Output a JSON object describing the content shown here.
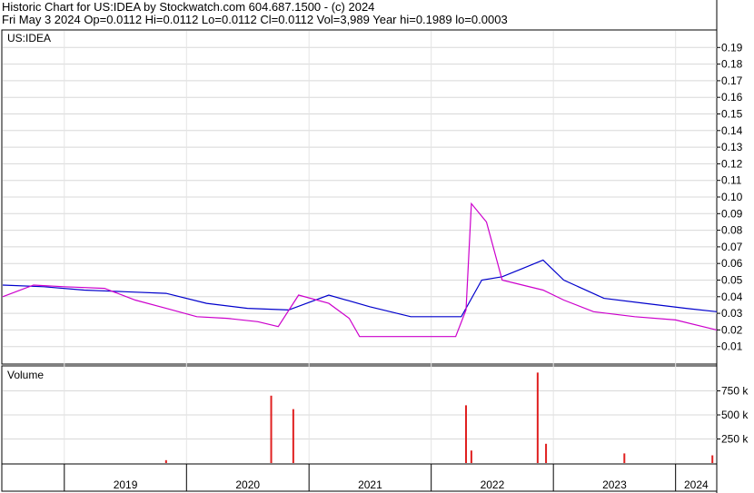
{
  "header": {
    "line1": "Historic Chart for US:IDEA by Stockwatch.com 604.687.1500 - (c) 2024",
    "line2": "Fri May  3 2024   Op=0.0112   Hi=0.0112   Lo=0.0112   Cl=0.0112   Vol=3,989   Year hi=0.1989   lo=0.0003"
  },
  "chart_data": {
    "type": "bar",
    "symbol_label": "US:IDEA",
    "volume_label": "Volume",
    "price_axis": {
      "range": [
        0,
        0.2
      ],
      "ticks": [
        "0.01",
        "0.02",
        "0.03",
        "0.04",
        "0.05",
        "0.06",
        "0.07",
        "0.08",
        "0.09",
        "0.10",
        "0.11",
        "0.12",
        "0.13",
        "0.14",
        "0.15",
        "0.16",
        "0.17",
        "0.18",
        "0.19"
      ]
    },
    "volume_axis": {
      "range": [
        0,
        1000000
      ],
      "ticks": [
        "250 k",
        "500 k",
        "750 k"
      ]
    },
    "time_axis": {
      "range": [
        "2018-07-01",
        "2024-05-03"
      ],
      "labels": [
        "2019",
        "2020",
        "2021",
        "2022",
        "2023",
        "2024"
      ]
    },
    "series": [
      {
        "name": "",
        "kind": "moving-average-long",
        "color": "#0000cc",
        "x": [
          "2018-07-01",
          "2018-11-01",
          "2019-03-01",
          "2019-07-01",
          "2019-11-01",
          "2020-03-01",
          "2020-07-01",
          "2020-11-01",
          "2021-03-01",
          "2021-07-01",
          "2021-11-01",
          "2022-02-01",
          "2022-04-01",
          "2022-06-01",
          "2022-08-01",
          "2022-10-01",
          "2022-12-01",
          "2023-02-01",
          "2023-06-01",
          "2023-10-01",
          "2024-02-01",
          "2024-05-03"
        ],
        "y": [
          0.047,
          0.046,
          0.044,
          0.043,
          0.042,
          0.036,
          0.033,
          0.032,
          0.041,
          0.034,
          0.028,
          0.028,
          0.028,
          0.05,
          0.052,
          0.057,
          0.062,
          0.05,
          0.039,
          0.036,
          0.033,
          0.031
        ]
      },
      {
        "name": "",
        "kind": "moving-average-short",
        "color": "#cc00cc",
        "x": [
          "2018-07-01",
          "2018-10-01",
          "2019-01-01",
          "2019-05-01",
          "2019-08-01",
          "2019-11-01",
          "2020-02-01",
          "2020-05-01",
          "2020-08-01",
          "2020-10-01",
          "2020-12-01",
          "2021-03-01",
          "2021-05-01",
          "2021-06-01",
          "2021-12-01",
          "2022-03-15",
          "2022-04-15",
          "2022-05-01",
          "2022-06-15",
          "2022-08-01",
          "2022-10-01",
          "2022-12-01",
          "2023-02-01",
          "2023-05-01",
          "2023-09-01",
          "2024-01-01",
          "2024-05-03"
        ],
        "y": [
          0.04,
          0.047,
          0.046,
          0.045,
          0.038,
          0.033,
          0.028,
          0.027,
          0.025,
          0.022,
          0.041,
          0.036,
          0.027,
          0.016,
          0.016,
          0.016,
          0.032,
          0.096,
          0.085,
          0.05,
          0.047,
          0.044,
          0.038,
          0.031,
          0.028,
          0.026,
          0.02
        ]
      }
    ],
    "volume_bars": {
      "x": [
        "2019-11-01",
        "2020-09-10",
        "2020-11-15",
        "2022-04-15",
        "2022-05-01",
        "2022-11-15",
        "2022-12-10",
        "2023-08-01",
        "2024-04-20"
      ],
      "values": [
        30000,
        700000,
        560000,
        600000,
        130000,
        940000,
        200000,
        100000,
        80000
      ]
    }
  }
}
